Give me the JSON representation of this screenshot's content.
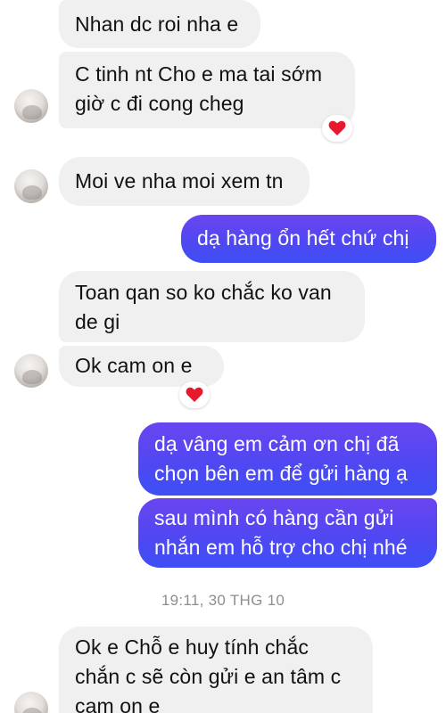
{
  "messages": [
    {
      "id": "m1",
      "text": "Nhan dc roi nha e"
    },
    {
      "id": "m2",
      "text": "C tinh nt Cho e ma tai sớm\ngiờ c đi cong cheg"
    },
    {
      "id": "m3",
      "text": "Moi ve nha moi xem tn"
    },
    {
      "id": "m4",
      "text": "dạ hàng ổn hết chứ chị"
    },
    {
      "id": "m5",
      "text": "Toan qan so ko chắc ko van\nde gi"
    },
    {
      "id": "m6",
      "text": "Ok cam on e"
    },
    {
      "id": "m7",
      "text": "dạ vâng em cảm ơn chị đã\nchọn bên em để gửi hàng ạ"
    },
    {
      "id": "m8",
      "text": "sau mình có hàng cần gửi\nnhắn em hỗ trợ cho chị nhé"
    },
    {
      "id": "m9",
      "text": "Ok e Chỗ e huy tính chắc\nchắn c sẽ còn gửi e an tâm c\ncam on e"
    }
  ],
  "reactions": {
    "m2": "red-heart",
    "m6": "red-heart"
  },
  "timestamp": "19:11, 30 THG 10",
  "colors": {
    "incoming_bubble": "#f0f0f0",
    "outgoing_gradient_top": "#6a45f0",
    "outgoing_gradient_bottom": "#3d4ff5",
    "heart": "#e8192c",
    "timestamp_text": "#8e8e93"
  }
}
